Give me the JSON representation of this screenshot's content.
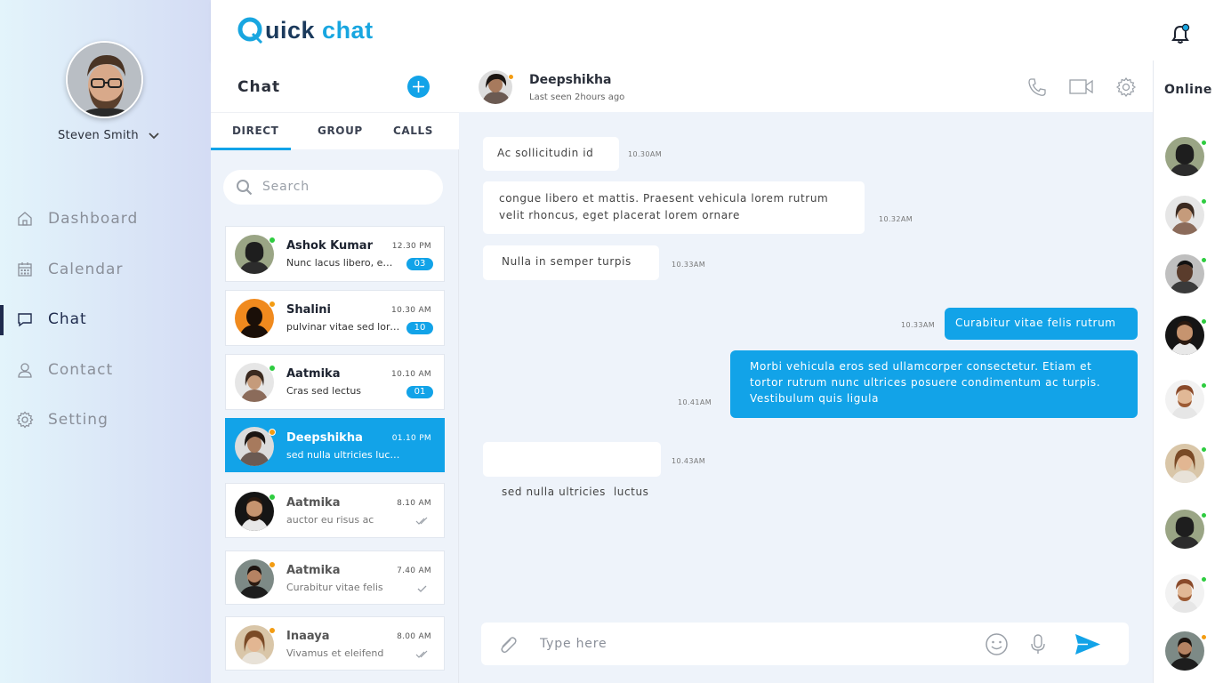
{
  "app": {
    "logo_first": "Quick",
    "logo_q_letter": "uick",
    "logo_second": "chat"
  },
  "colors": {
    "accent": "#12a3e8",
    "online": "#2ecc40",
    "away": "#f39c12",
    "nav_active": "#1f2b4d"
  },
  "profile": {
    "name": "Steven Smith"
  },
  "nav": [
    {
      "label": "Dashboard",
      "icon": "home-icon"
    },
    {
      "label": "Calendar",
      "icon": "calendar-icon"
    },
    {
      "label": "Chat",
      "icon": "chat-icon",
      "active": true
    },
    {
      "label": "Contact",
      "icon": "user-icon"
    },
    {
      "label": "Setting",
      "icon": "gear-icon"
    }
  ],
  "chat_list": {
    "title": "Chat",
    "tabs": [
      "DIRECT",
      "GROUP",
      "CALLS"
    ],
    "active_tab": "DIRECT",
    "search_placeholder": "Search",
    "items": [
      {
        "name": "Ashok Kumar",
        "time": "12.30 PM",
        "preview": "Nunc lacus libero, efficitur",
        "badge": "03",
        "status": "online"
      },
      {
        "name": "Shalini",
        "time": "10.30 AM",
        "preview": "pulvinar vitae sed lorem",
        "badge": "10",
        "status": "away"
      },
      {
        "name": "Aatmika",
        "time": "10.10 AM",
        "preview": "Cras sed lectus",
        "badge": "01",
        "status": "online"
      },
      {
        "name": "Deepshikha",
        "time": "01.10 PM",
        "preview": "sed nulla ultricies luctus",
        "status": "away",
        "active": true
      },
      {
        "name": "Aatmika",
        "time": "8.10 AM",
        "preview": "auctor eu risus ac",
        "read": "double-check",
        "status": "online"
      },
      {
        "name": "Aatmika",
        "time": "7.40 AM",
        "preview": "Curabitur vitae felis",
        "read": "check",
        "status": "away"
      },
      {
        "name": "Inaaya",
        "time": "8.00 AM",
        "preview": "Vivamus et eleifend",
        "read": "double-check",
        "status": "away"
      }
    ]
  },
  "conversation": {
    "contact_name": "Deepshikha",
    "last_seen": "Last seen 2hours ago",
    "composer_placeholder": "Type here",
    "messages": [
      {
        "dir": "in",
        "lines": [
          "Ac sollicitudin id"
        ],
        "time": "10.30AM"
      },
      {
        "dir": "in",
        "lines": [
          "congue libero et mattis. Praesent vehicula lorem rutrum",
          "velit rhoncus, eget placerat lorem ornare"
        ],
        "time": "10.32AM"
      },
      {
        "dir": "in",
        "lines": [
          "Nulla in semper turpis"
        ],
        "time": "10.33AM"
      },
      {
        "dir": "out",
        "lines": [
          "Curabitur vitae felis rutrum"
        ],
        "time": "10.33AM"
      },
      {
        "dir": "out",
        "lines": [
          "Morbi vehicula eros sed ullamcorper consectetur. Etiam et",
          "tortor rutrum nunc ultrices posuere condimentum ac turpis.",
          "Vestibulum quis ligula"
        ],
        "time": "10.41AM"
      },
      {
        "dir": "in",
        "lines": [
          "sed nulla ultricies  luctus"
        ],
        "time": "10.43AM"
      }
    ]
  },
  "online": {
    "title": "Online",
    "users": [
      {
        "status": "online"
      },
      {
        "status": "online"
      },
      {
        "status": "online"
      },
      {
        "status": "online"
      },
      {
        "status": "online"
      },
      {
        "status": "online"
      },
      {
        "status": "online"
      },
      {
        "status": "online"
      },
      {
        "status": "away"
      }
    ]
  }
}
